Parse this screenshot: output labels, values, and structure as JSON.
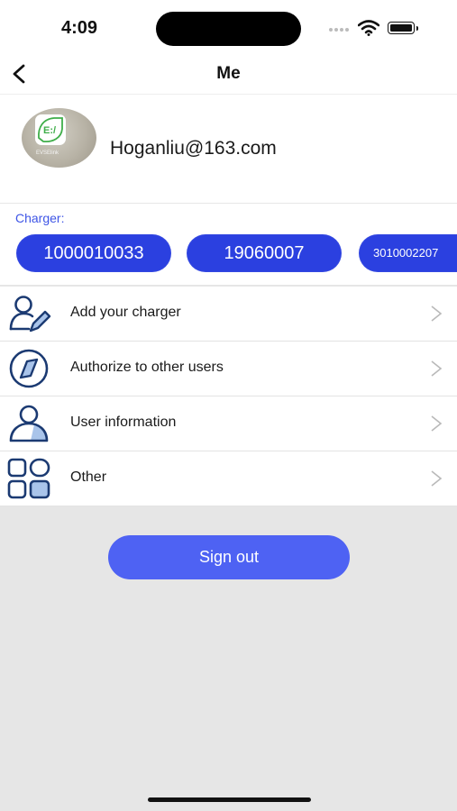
{
  "status_bar": {
    "time": "4:09"
  },
  "nav": {
    "title": "Me"
  },
  "profile": {
    "email": "Hoganliu@163.com",
    "logo_mark": "E:/",
    "logo_caption": "EVSElink"
  },
  "chargers": {
    "label": "Charger:",
    "items": [
      "1000010033",
      "19060007",
      "3010002207"
    ]
  },
  "menu": [
    {
      "label": "Add your charger",
      "icon": "add-charger-icon"
    },
    {
      "label": "Authorize to other users",
      "icon": "authorize-icon"
    },
    {
      "label": "User information",
      "icon": "user-icon"
    },
    {
      "label": "Other",
      "icon": "grid-icon"
    }
  ],
  "sign_out": {
    "label": "Sign out"
  },
  "colors": {
    "accent": "#2b40e0",
    "button": "#4e62f3",
    "icon_stroke": "#1b3a72",
    "icon_fill": "#a9c4ea",
    "background": "#e6e6e6"
  }
}
